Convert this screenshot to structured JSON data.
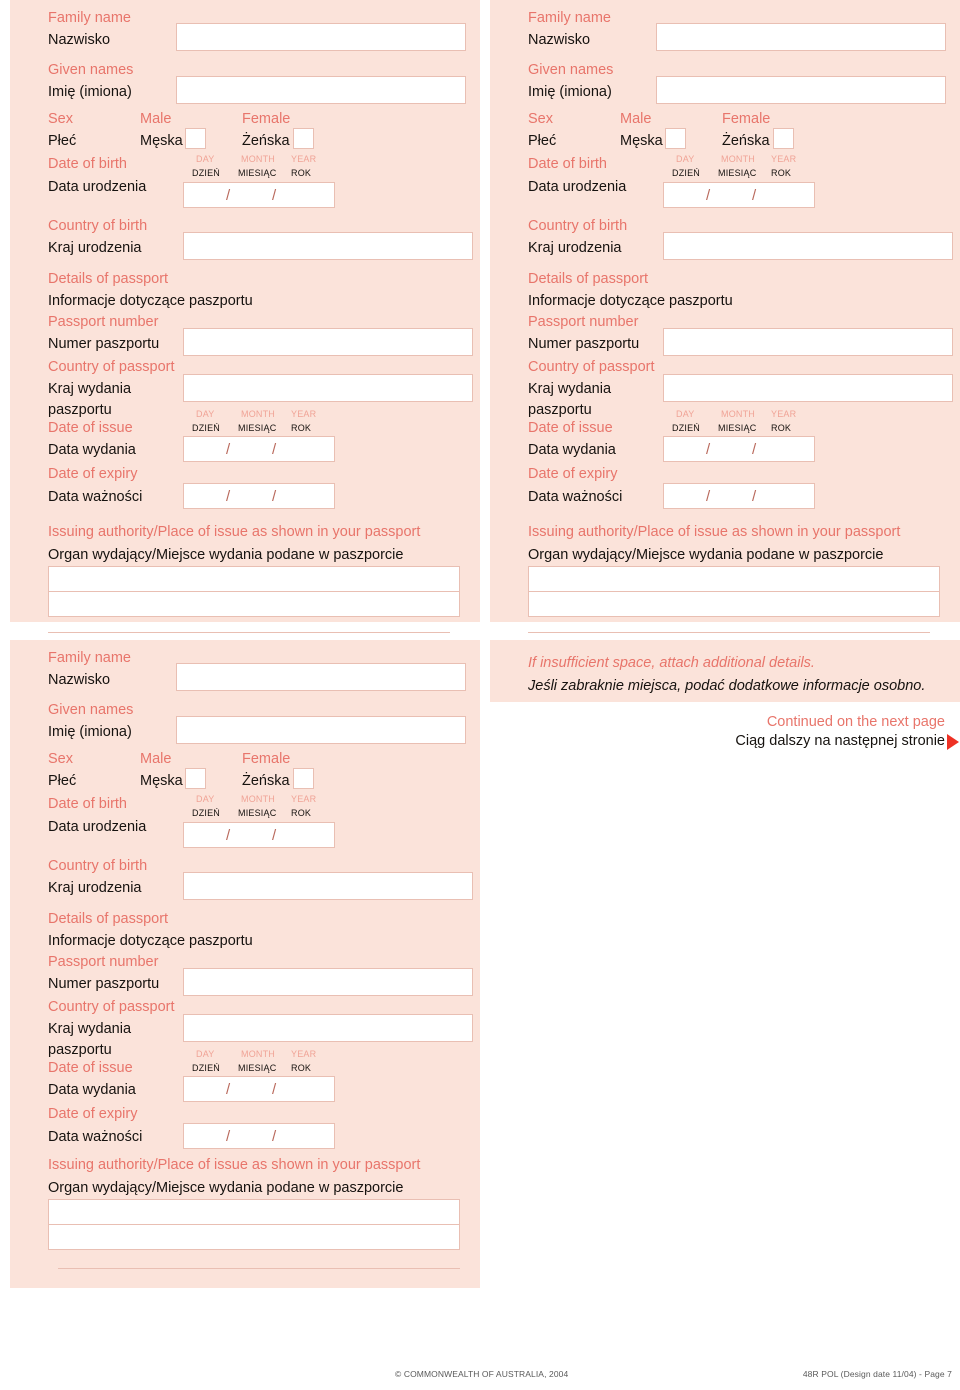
{
  "form": {
    "labels": {
      "family_name_en": "Family name",
      "family_name_pl": "Nazwisko",
      "given_names_en": "Given names",
      "given_names_pl": "Imię (imiona)",
      "sex_en": "Sex",
      "sex_pl": "Płeć",
      "male_en": "Male",
      "male_pl": "Męska",
      "female_en": "Female",
      "female_pl": "Żeńska",
      "date_of_birth_en": "Date of birth",
      "date_of_birth_pl": "Data urodzenia",
      "country_of_birth_en": "Country of birth",
      "country_of_birth_pl": "Kraj urodzenia",
      "details_of_passport_en": "Details of passport",
      "details_of_passport_pl": "Informacje dotyczące paszportu",
      "passport_number_en": "Passport number",
      "passport_number_pl": "Numer paszportu",
      "country_of_passport_en": "Country of passport",
      "country_of_passport_pl_1": "Kraj wydania",
      "country_of_passport_pl_2": "paszportu",
      "date_of_issue_en": "Date of issue",
      "date_of_issue_pl": "Data wydania",
      "date_of_expiry_en": "Date of expiry",
      "date_of_expiry_pl": "Data ważności",
      "issuing_authority_en": "Issuing authority/Place of issue as shown in your passport",
      "issuing_authority_pl": "Organ wydający/Miejsce wydania podane w paszporcie",
      "day_en": "DAY",
      "day_pl": "DZIEŃ",
      "month_en": "MONTH",
      "month_pl": "MIESIĄC",
      "year_en": "YEAR",
      "year_pl": "ROK",
      "slash": "/"
    },
    "values": {
      "family_name": "",
      "given_names": "",
      "male_checked": "",
      "female_checked": "",
      "date_of_birth": "",
      "country_of_birth": "",
      "passport_number": "",
      "country_of_passport": "",
      "date_of_issue": "",
      "date_of_expiry": "",
      "issuing_authority_line1": "",
      "issuing_authority_line2": ""
    }
  },
  "note": {
    "en": "If insufficient space, attach additional details.",
    "pl": "Jeśli zabraknie miejsca, podać dodatkowe informacje osobno."
  },
  "continued": {
    "en": "Continued on the next page",
    "pl": "Ciąg dalszy na następnej stronie",
    "arrow": "right-triangle-icon"
  },
  "footer": {
    "copyright": "© COMMONWEALTH OF AUSTRALIA, 2004",
    "form_id": "48R POL (Design date 11/04) - Page 7"
  },
  "colors": {
    "panel_background": "#fbe3da",
    "english_label": "#e8756b",
    "polish_label": "#16120f",
    "field_border": "#e9bfb3",
    "field_fill": "#ffffff",
    "arrow_red": "#ee3124",
    "page_background": "#ffffff"
  }
}
